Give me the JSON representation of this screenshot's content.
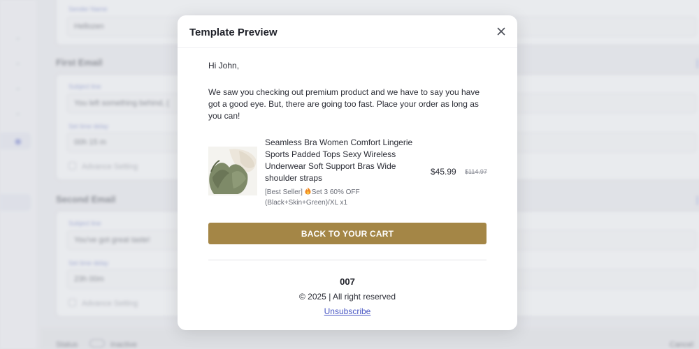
{
  "background": {
    "sender_name_label": "Sender Name",
    "sender_name_value": "Hellozen",
    "sections": [
      {
        "title": "First Email",
        "subject_label": "Subject line",
        "subject_value": "You left something behind, {",
        "delay_label": "Set time delay",
        "delay_value": "00h 15 m",
        "advance_label": "Advance Setting"
      },
      {
        "title": "Second Email",
        "subject_label": "Subject line",
        "subject_value": "You've got great taste!",
        "delay_label": "Set time delay",
        "delay_value": "23h 00m",
        "advance_label": "Advance Setting"
      }
    ],
    "footer": {
      "status_label": "Status",
      "status_value": "Inactive",
      "cancel_label": "Cancel"
    }
  },
  "modal": {
    "title": "Template Preview",
    "close_icon": "close-icon",
    "email": {
      "greeting": "Hi John,",
      "body": "We saw you checking out premium product and we have to say you have got a good eye. But, there are going too fast. Place your order as long as you can!",
      "product": {
        "name": "Seamless Bra Women Comfort Lingerie Sports Padded Tops Sexy Wireless Underwear Soft Support Bras Wide shoulder straps",
        "variant_prefix": "[Best Seller]",
        "variant_rest": "Set 3 60% OFF (Black+Skin+Green)/XL x1",
        "price": "$45.99",
        "old_price": "$114.97"
      },
      "cta_label": "BACK TO YOUR CART",
      "brand": "007",
      "copyright": "© 2025 | All right reserved",
      "unsubscribe_label": "Unsubscribe"
    }
  },
  "colors": {
    "cta": "#a48646",
    "link": "#4a58c4",
    "title": "#1f2129"
  }
}
